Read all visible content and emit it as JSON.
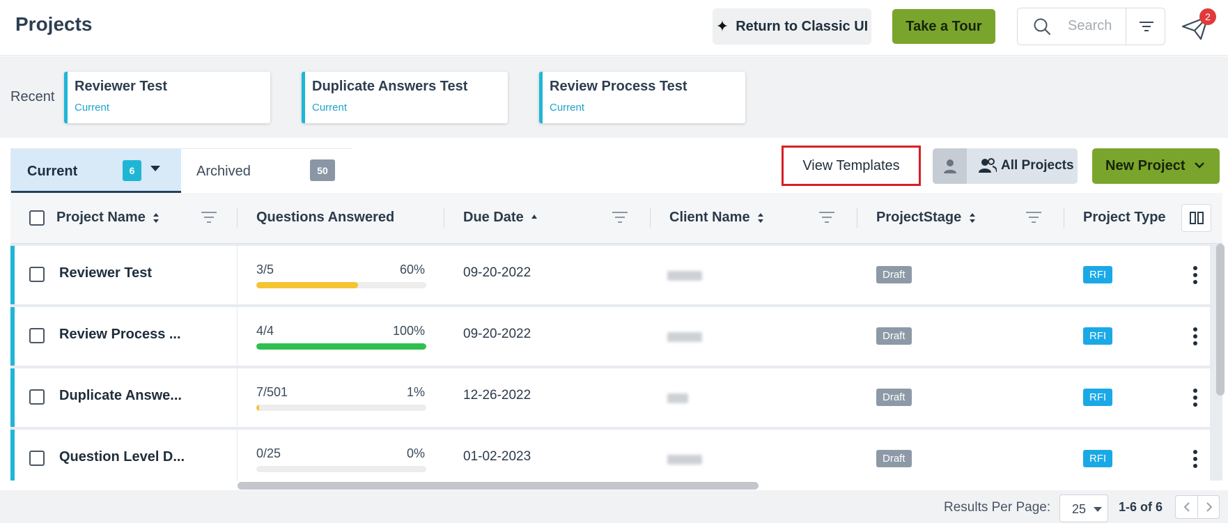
{
  "header": {
    "title": "Projects",
    "classic_ui_label": "Return to Classic UI",
    "tour_label": "Take a Tour",
    "search_placeholder": "Search",
    "notification_count": "2"
  },
  "recent": {
    "label": "Recent",
    "items": [
      {
        "title": "Reviewer Test",
        "status": "Current"
      },
      {
        "title": "Duplicate Answers Test",
        "status": "Current"
      },
      {
        "title": "Review Process Test",
        "status": "Current"
      }
    ]
  },
  "tabs": {
    "current": {
      "label": "Current",
      "count": "6"
    },
    "archived": {
      "label": "Archived",
      "count": "50"
    }
  },
  "actions": {
    "view_templates": "View Templates",
    "all_projects": "All Projects",
    "new_project": "New Project"
  },
  "table": {
    "columns": {
      "project_name": "Project Name",
      "questions_answered": "Questions Answered",
      "due_date": "Due Date",
      "client_name": "Client Name",
      "project_stage": "ProjectStage",
      "project_type": "Project Type"
    },
    "rows": [
      {
        "name": "Reviewer Test",
        "answered": "3/5",
        "percent_label": "60%",
        "percent": 0.6,
        "bar_color": "#f5c431",
        "due": "09-20-2022",
        "stage": "Draft",
        "type": "RFI"
      },
      {
        "name": "Review Process ...",
        "answered": "4/4",
        "percent_label": "100%",
        "percent": 1.0,
        "bar_color": "#2fbf4e",
        "due": "09-20-2022",
        "stage": "Draft",
        "type": "RFI"
      },
      {
        "name": "Duplicate Answe...",
        "answered": "7/501",
        "percent_label": "1%",
        "percent": 0.01,
        "bar_color": "#f5c431",
        "due": "12-26-2022",
        "stage": "Draft",
        "type": "RFI"
      },
      {
        "name": "Question Level D...",
        "answered": "0/25",
        "percent_label": "0%",
        "percent": 0.0,
        "bar_color": "#f5c431",
        "due": "01-02-2023",
        "stage": "Draft",
        "type": "RFI"
      }
    ]
  },
  "footer": {
    "results_per_page_label": "Results Per Page:",
    "results_per_page": "25",
    "range": "1-6 of 6"
  },
  "colors": {
    "accent_teal": "#1fb6d6",
    "primary_green": "#7aa52c",
    "highlight_red": "#d61f26",
    "rfi_blue": "#1aa9e6",
    "draft_gray": "#8d99a6"
  }
}
